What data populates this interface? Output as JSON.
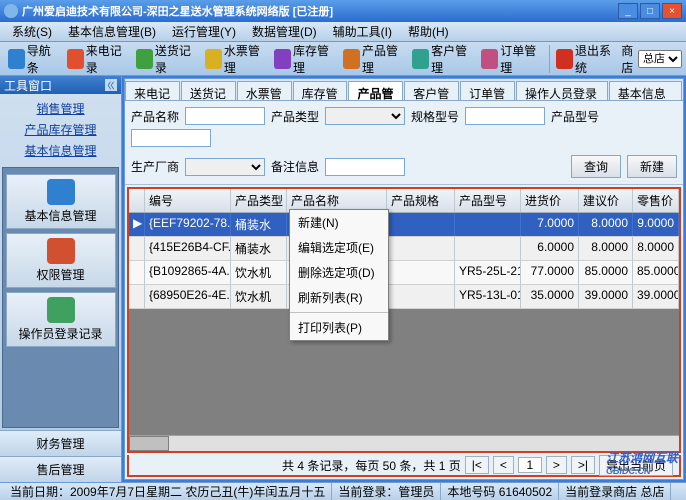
{
  "window": {
    "title": "广州爱启迪技术有限公司-深田之星送水管理系统网络版 [已注册]"
  },
  "menu": [
    "系统(S)",
    "基本信息管理(B)",
    "运行管理(Y)",
    "数据管理(D)",
    "辅助工具(I)",
    "帮助(H)"
  ],
  "toolbar": {
    "items": [
      {
        "label": "导航条",
        "color": "#3080d0"
      },
      {
        "label": "来电记录",
        "color": "#e05030"
      },
      {
        "label": "送货记录",
        "color": "#40a040"
      },
      {
        "label": "水票管理",
        "color": "#d8b020"
      },
      {
        "label": "库存管理",
        "color": "#8040c0"
      },
      {
        "label": "产品管理",
        "color": "#d07020"
      },
      {
        "label": "客户管理",
        "color": "#30a090"
      },
      {
        "label": "订单管理",
        "color": "#c05080"
      }
    ],
    "exit": "退出系统",
    "store_label": "商店",
    "store_value": "总店"
  },
  "sidebar": {
    "title": "工具窗口",
    "collapse": "ㄍ",
    "links": [
      "销售管理",
      "产品库存管理",
      "基本信息管理"
    ],
    "buttons": [
      {
        "label": "基本信息管理",
        "color": "#3080d0"
      },
      {
        "label": "权限管理",
        "color": "#d05030"
      },
      {
        "label": "操作员登录记录",
        "color": "#40a060"
      }
    ],
    "foot": [
      "财务管理",
      "售后管理"
    ]
  },
  "tabs": [
    "来电记录",
    "送货记录",
    "水票管理",
    "库存管理",
    "产品管理",
    "客户管理",
    "订单管理",
    "操作人员登录记录",
    "基本信息管理"
  ],
  "active_tab": 4,
  "filters": {
    "name_label": "产品名称",
    "type_label": "产品类型",
    "spec_label": "规格型号",
    "pno_label": "产品型号",
    "factory_label": "生产厂商",
    "note_label": "备注信息",
    "query": "查询",
    "new": "新建"
  },
  "grid": {
    "cols": [
      "",
      "编号",
      "产品类型",
      "产品名称",
      "产品规格",
      "产品型号",
      "进货价",
      "建议价",
      "零售价"
    ],
    "rows": [
      {
        "id": "{EEF79202-78...",
        "type": "桶装水",
        "name": "",
        "spec": "",
        "model": "",
        "buy": "7.0000",
        "sug": "8.0000",
        "sell": "9.0000",
        "sel": true
      },
      {
        "id": "{415E26B4-CF...",
        "type": "桶装水",
        "name": "",
        "spec": "",
        "model": "",
        "buy": "6.0000",
        "sug": "8.0000",
        "sell": "8.0000"
      },
      {
        "id": "{B1092865-4A...",
        "type": "饮水机",
        "name": "",
        "spec": "",
        "model": "YR5-25L-21",
        "buy": "77.0000",
        "sug": "85.0000",
        "sell": "85.0000"
      },
      {
        "id": "{68950E26-4E...",
        "type": "饮水机",
        "name": "",
        "spec": "",
        "model": "YR5-13L-01",
        "buy": "35.0000",
        "sug": "39.0000",
        "sell": "39.0000"
      }
    ]
  },
  "context_menu": [
    "新建(N)",
    "编辑选定项(E)",
    "删除选定项(D)",
    "刷新列表(R)",
    "打印列表(P)"
  ],
  "pager": {
    "summary": "共 4 条记录，每页 50 条，共 1 页",
    "first": "|<",
    "prev": "<",
    "page": "1",
    "next": ">",
    "last": ">|",
    "export": "导出当前页"
  },
  "status": {
    "date": "当前日期：2009年7月7日星期二 农历己丑(牛)年闰五月十五",
    "user": "当前登录：管理员",
    "code": "本地号码 61640502",
    "store": "当前登录商店 总店"
  },
  "watermark": {
    "main": "江苏鸿网互联",
    "sub": "GBIDC.CN"
  }
}
